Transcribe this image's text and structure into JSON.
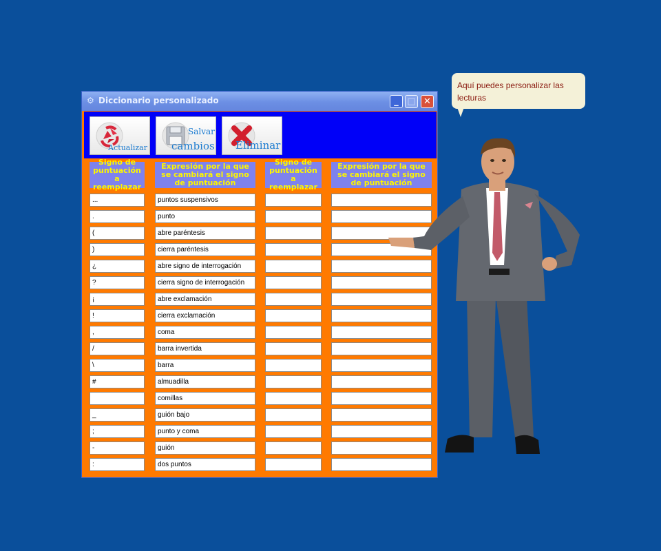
{
  "window": {
    "title": "Diccionario personalizado",
    "app_icon": "window-app-icon",
    "controls": {
      "minimize": "_",
      "maximize": "□",
      "close": "✕"
    }
  },
  "toolbar": {
    "update_label": "Actualizar",
    "save_label_1": "Salvar",
    "save_label_2": "cambios",
    "delete_label": "Eliminar",
    "icons": [
      "recycle-icon",
      "floppy-disk-icon",
      "x-icon"
    ]
  },
  "table": {
    "headers": [
      "Signo de puntuación a reemplazar",
      "Expresión por la que se cambiará el signo de puntuación",
      "Signo de puntuación a reemplazar",
      "Expresión por la que se cambiará el signo de puntuación"
    ],
    "rows": [
      {
        "sign": "...",
        "expr": "puntos suspensivos"
      },
      {
        "sign": ".",
        "expr": "punto"
      },
      {
        "sign": "(",
        "expr": "abre paréntesis"
      },
      {
        "sign": ")",
        "expr": "cierra paréntesis"
      },
      {
        "sign": "¿",
        "expr": "abre signo de interrogación"
      },
      {
        "sign": "?",
        "expr": "cierra signo de interrogación"
      },
      {
        "sign": "¡",
        "expr": "abre exclamación"
      },
      {
        "sign": "!",
        "expr": "cierra exclamación"
      },
      {
        "sign": ",",
        "expr": "coma"
      },
      {
        "sign": "/",
        "expr": "barra invertida"
      },
      {
        "sign": "\\",
        "expr": "barra"
      },
      {
        "sign": "#",
        "expr": "almuadilla"
      },
      {
        "sign": "",
        "expr": "comillas"
      },
      {
        "sign": "_",
        "expr": "guión bajo"
      },
      {
        "sign": ";",
        "expr": "punto y coma"
      },
      {
        "sign": "-",
        "expr": "guión"
      },
      {
        "sign": ":",
        "expr": "dos puntos"
      }
    ]
  },
  "assistant": {
    "message": "Aquí puedes personalizar las lecturas"
  },
  "colors": {
    "desktop": "#0a4f9b",
    "table_bg": "#ff7a00",
    "toolbar_bg": "#0000f8",
    "header_bg": "#7e82ee",
    "header_text": "#fdf600"
  }
}
